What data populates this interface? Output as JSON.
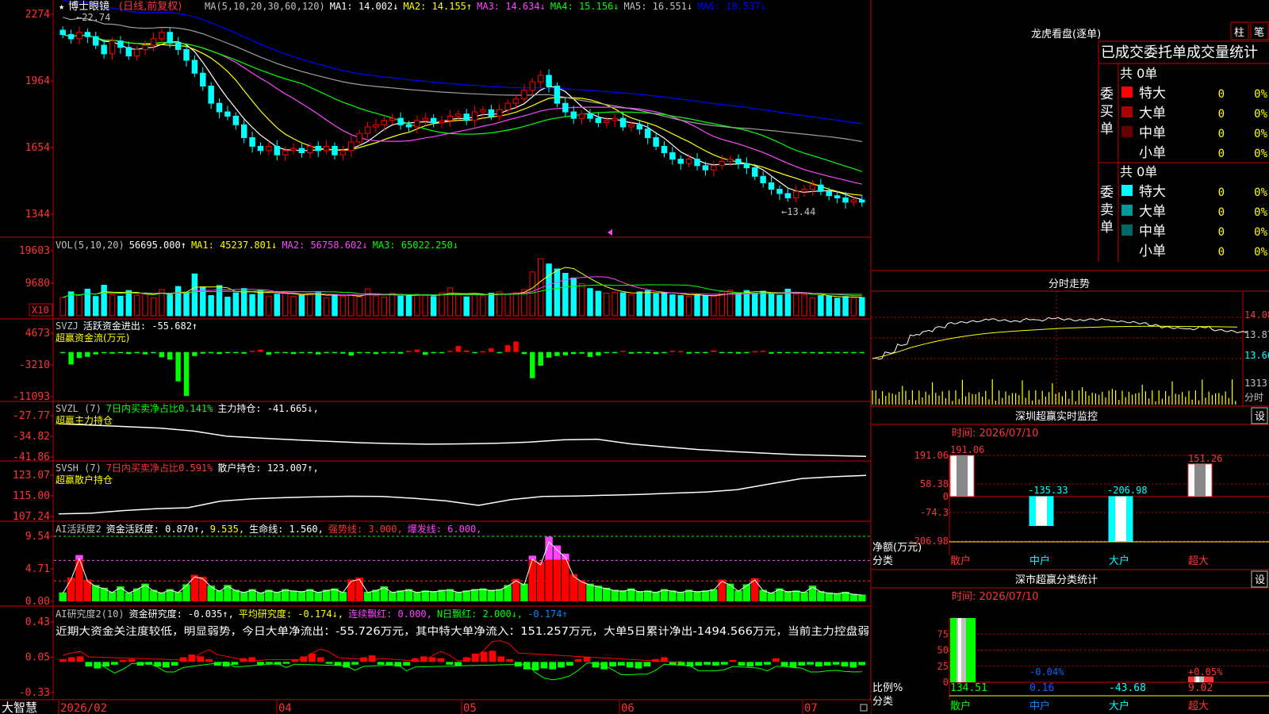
{
  "left": {
    "main": {
      "star_prefix": "★",
      "stock_name": "博士眼镜",
      "period_label": "(日线,前复权)",
      "ma_legend": [
        {
          "text": "MA(5,10,20,30,60,120)",
          "color": "#c0c0c0"
        },
        {
          "text": "MA1: 14.002↓",
          "color": "#ffffff"
        },
        {
          "text": "MA2: 14.155↑",
          "color": "#ffff00"
        },
        {
          "text": "MA3: 14.634↓",
          "color": "#ff44ff"
        },
        {
          "text": "MA4: 15.156↓",
          "color": "#00ff00"
        },
        {
          "text": "MA5: 16.551↓",
          "color": "#c0c0c0"
        },
        {
          "text": "MA6: 18.537↓",
          "color": "#0000ff"
        }
      ],
      "y_ticks": [
        "2274",
        "1964",
        "1654",
        "1344"
      ],
      "high_label": "←22.74",
      "low_label": "←13.44"
    },
    "vol": {
      "legend": [
        {
          "text": "VOL(5,10,20)",
          "color": "#c0c0c0"
        },
        {
          "text": "56695.000↑",
          "color": "#ffffff"
        },
        {
          "text": "MA1: 45237.801↓",
          "color": "#ffff00"
        },
        {
          "text": "MA2: 56758.602↓",
          "color": "#ff44ff"
        },
        {
          "text": "MA3: 65022.250↓",
          "color": "#00ff00"
        }
      ],
      "y_ticks": [
        "19603",
        "9680"
      ],
      "unit_label": "X10"
    },
    "svzj": {
      "legend": [
        {
          "text": "SVZJ",
          "color": "#c0c0c0"
        },
        {
          "text": "活跃资金进出: -55.682↑",
          "color": "#ffffff"
        }
      ],
      "subtitle": "超赢资金流(万元)",
      "y_ticks": [
        "4673",
        "-3210",
        "-11093"
      ]
    },
    "svzl": {
      "legend": [
        {
          "text": "SVZL (7)",
          "color": "#c0c0c0"
        },
        {
          "text": "7日内买卖净占比0.141%",
          "color": "#00ff00"
        },
        {
          "text": "主力持仓: -41.665↓,",
          "color": "#ffffff"
        }
      ],
      "subtitle": "超赢主力持仓",
      "y_ticks": [
        "-27.77",
        "-34.82",
        "-41.86"
      ]
    },
    "svsh": {
      "legend": [
        {
          "text": "SVSH (7)",
          "color": "#c0c0c0"
        },
        {
          "text": "7日内买卖净占比0.591%",
          "color": "#ff3333"
        },
        {
          "text": "散户持仓: 123.007↑,",
          "color": "#ffffff"
        }
      ],
      "subtitle": "超赢散户持仓",
      "y_ticks": [
        "123.07",
        "115.00",
        "107.24"
      ]
    },
    "ai_active": {
      "legend": [
        {
          "text": "AI活跃度2",
          "color": "#c0c0c0"
        },
        {
          "text": "资金活跃度: 0.870↑,",
          "color": "#ffffff"
        },
        {
          "text": "9.535,",
          "color": "#ffff00"
        },
        {
          "text": "生命线: 1.560,",
          "color": "#ffffff"
        },
        {
          "text": "强势线: 3.000,",
          "color": "#ff3333"
        },
        {
          "text": "爆发线: 6.000,",
          "color": "#ff44ff"
        }
      ],
      "y_ticks": [
        "9.54",
        "4.71",
        "0.00"
      ]
    },
    "ai_research": {
      "legend": [
        {
          "text": "AI研究度2(10)",
          "color": "#c0c0c0"
        },
        {
          "text": "资金研究度: -0.035↑,",
          "color": "#ffffff"
        },
        {
          "text": "平均研究度: -0.174↓,",
          "color": "#ffff00"
        },
        {
          "text": "连续飘红: 0.000,",
          "color": "#ff44ff"
        },
        {
          "text": "N日飘红: 2.000↓,",
          "color": "#00ff00"
        },
        {
          "text": "-0.174↑",
          "color": "#0088ff"
        }
      ],
      "commentary": "近期大资金关注度较低，明显弱势，今日大单净流出：-55.726万元，其中特大单净流入：151.257万元，大单5日累计净出-1494.566万元，当前主力控盘弱",
      "y_ticks": [
        "0.43",
        "0.05",
        "-0.33"
      ]
    },
    "time_axis": {
      "brand": "大智慧",
      "labels": [
        "2026/02",
        "04",
        "05",
        "06",
        "07"
      ]
    }
  },
  "right": {
    "order_panel": {
      "title": "龙虎看盘(逐单)",
      "tab_bar": "柱",
      "tab_stroke": "笔",
      "header": "已成交委托单成交量统计",
      "buy": {
        "side_label": "委买单",
        "total": "共 0单",
        "rows": [
          {
            "label": "特大",
            "count": "0",
            "pct": "0%",
            "color": "#ff0000"
          },
          {
            "label": "大单",
            "count": "0",
            "pct": "0%",
            "color": "#aa0000"
          },
          {
            "label": "中单",
            "count": "0",
            "pct": "0%",
            "color": "#660000"
          },
          {
            "label": "小单",
            "count": "0",
            "pct": "0%",
            "color": ""
          }
        ]
      },
      "sell": {
        "side_label": "委卖单",
        "total": "共 0单",
        "rows": [
          {
            "label": "特大",
            "count": "0",
            "pct": "0%",
            "color": "#00ffff"
          },
          {
            "label": "大单",
            "count": "0",
            "pct": "0%",
            "color": "#009999"
          },
          {
            "label": "中单",
            "count": "0",
            "pct": "0%",
            "color": "#006666"
          },
          {
            "label": "小单",
            "count": "0",
            "pct": "0%",
            "color": ""
          }
        ]
      }
    },
    "intraday": {
      "title": "分时走势",
      "price_ticks": [
        "14.08",
        "13.87",
        "13.66"
      ],
      "vol_tick": "1313",
      "vol_unit": "分时"
    },
    "monitor": {
      "title": "深圳超赢实时监控",
      "settings": "设",
      "time": "时间: 2026/07/10",
      "y_ticks": [
        "191.06",
        "58.38",
        "0",
        "-74.3",
        "-206.98"
      ],
      "net_label": "净额(万元)",
      "cat_label": "分类",
      "categories": [
        "散户",
        "中户",
        "大户",
        "超大"
      ],
      "values": [
        191.06,
        -135.33,
        -206.98,
        151.26
      ],
      "value_labels": [
        "191.06",
        "-135.33",
        "-206.98",
        "151.26"
      ]
    },
    "classify": {
      "title": "深市超赢分类统计",
      "settings": "设",
      "time": "时间: 2026/07/10",
      "y_ticks": [
        "75",
        "50",
        "25",
        "0"
      ],
      "ratio_label": "比例%",
      "cat_label": "分类",
      "categories": [
        "散户",
        "中户",
        "大户",
        "超大"
      ],
      "values": [
        134.51,
        0.16,
        -43.68,
        9.02
      ],
      "bottom_labels": [
        "134.51",
        "0.16",
        "-43.68",
        "9.02"
      ],
      "top_labels": [
        "",
        "-0.04%",
        "",
        "+0.05%"
      ]
    }
  },
  "chart_data": [
    {
      "type": "candlestick",
      "title": "博士眼镜(日线,前复权)",
      "x": [
        "2026/02",
        "04",
        "05",
        "06",
        "07"
      ],
      "ylim": [
        13.44,
        22.74
      ],
      "y_ticks": [
        22.74,
        19.64,
        16.54,
        13.44
      ],
      "close": [
        21.8,
        21.6,
        21.9,
        21.7,
        21.3,
        20.9,
        21.5,
        21.2,
        20.8,
        21.1,
        21.3,
        21.6,
        21.9,
        21.4,
        21.1,
        20.6,
        20.0,
        19.4,
        18.6,
        18.2,
        18.0,
        17.6,
        17.0,
        16.6,
        16.4,
        16.6,
        16.2,
        16.4,
        16.5,
        16.3,
        16.6,
        16.4,
        16.6,
        16.2,
        16.4,
        16.8,
        17.2,
        17.5,
        17.6,
        17.8,
        17.9,
        17.6,
        17.5,
        17.8,
        17.9,
        17.7,
        17.8,
        18.0,
        18.1,
        17.8,
        18.2,
        18.3,
        18.0,
        18.3,
        18.6,
        18.8,
        19.2,
        19.6,
        19.9,
        19.4,
        18.6,
        18.2,
        17.9,
        18.1,
        17.9,
        17.7,
        17.8,
        17.9,
        17.5,
        17.6,
        17.4,
        17.0,
        16.6,
        16.3,
        16.0,
        15.8,
        16.0,
        15.7,
        15.5,
        15.7,
        15.9,
        16.0,
        15.8,
        15.6,
        15.2,
        14.9,
        14.6,
        14.4,
        14.2,
        14.5,
        14.6,
        14.8,
        14.5,
        14.3,
        14.2,
        14.0,
        14.1,
        14.0
      ],
      "series": [
        {
          "name": "MA1",
          "value": 14.002
        },
        {
          "name": "MA2",
          "value": 14.155
        },
        {
          "name": "MA3",
          "value": 14.634
        },
        {
          "name": "MA4",
          "value": 15.156
        },
        {
          "name": "MA5",
          "value": 16.551
        },
        {
          "name": "MA6",
          "value": 18.537
        }
      ]
    },
    {
      "type": "bar",
      "title": "VOL(5,10,20)",
      "ylim": [
        0,
        19603
      ],
      "y_ticks": [
        19603,
        9680
      ],
      "values": [
        5500,
        7200,
        6100,
        8000,
        5800,
        9200,
        6400,
        5900,
        7600,
        6200,
        6800,
        5400,
        7900,
        6300,
        8800,
        7100,
        12600,
        8700,
        6100,
        9100,
        5600,
        6900,
        8200,
        6400,
        7800,
        5900,
        6500,
        7100,
        5800,
        6200,
        6600,
        7000,
        5400,
        6100,
        5900,
        6300,
        5700,
        8100,
        6000,
        5600,
        6700,
        5900,
        6200,
        6500,
        6100,
        5800,
        6900,
        8400,
        6300,
        5700,
        6400,
        6000,
        6800,
        7200,
        6500,
        6900,
        7900,
        13200,
        17200,
        15600,
        14100,
        12800,
        11400,
        9700,
        8200,
        7400,
        6800,
        7100,
        6900,
        6400,
        7200,
        7600,
        6600,
        6900,
        6300,
        6100,
        5800,
        6400,
        6000,
        5900,
        7300,
        7700,
        6700,
        7600,
        6800,
        7400,
        6700,
        6200,
        8000,
        6600,
        6300,
        5400,
        6100,
        5900,
        5300,
        5800,
        5400,
        5500
      ]
    },
    {
      "type": "bar",
      "title": "SVZJ 活跃资金进出",
      "ylim": [
        -11093,
        4673
      ],
      "y_ticks": [
        4673,
        -3210,
        -11093
      ],
      "values": [
        -200,
        -3100,
        -1500,
        -1200,
        -600,
        -300,
        -400,
        -300,
        -500,
        -200,
        -600,
        -300,
        -1300,
        -1900,
        -7300,
        -10900,
        -1000,
        -400,
        -200,
        -500,
        -300,
        -200,
        -400,
        300,
        600,
        -700,
        -300,
        -200,
        -500,
        -300,
        -200,
        -600,
        -300,
        -200,
        -400,
        -900,
        -300,
        -200,
        -500,
        -300,
        -200,
        -400,
        300,
        600,
        -700,
        -300,
        -200,
        300,
        1500,
        400,
        -300,
        200,
        900,
        -200,
        1700,
        2600,
        -500,
        -6500,
        -3400,
        -1400,
        -1000,
        -800,
        -500,
        -400,
        -1200,
        -900,
        -300,
        -200,
        300,
        -400,
        -300,
        -200,
        -500,
        -300,
        300,
        200,
        -400,
        -300,
        -200,
        400,
        -300,
        -200,
        -400,
        -300,
        200,
        300,
        -400,
        -300,
        -200,
        -300,
        -200,
        -300,
        -400,
        -200,
        -300,
        -200,
        -300,
        -100
      ]
    },
    {
      "type": "line",
      "title": "SVZL 主力持仓",
      "ylim": [
        -41.86,
        -27.77
      ],
      "y_ticks": [
        -27.77,
        -34.82,
        -41.86
      ],
      "values": [
        -30.5,
        -31.0,
        -31.5,
        -32.0,
        -33.0,
        -34.8,
        -35.4,
        -36.0,
        -36.5,
        -37.0,
        -37.3,
        -37.5,
        -37.4,
        -37.2,
        -36.8,
        -36.0,
        -35.8,
        -37.4,
        -38.4,
        -39.3,
        -40.0,
        -40.6,
        -41.1,
        -41.4,
        -41.665
      ]
    },
    {
      "type": "line",
      "title": "SVSH 散户持仓",
      "ylim": [
        107.24,
        123.07
      ],
      "y_ticks": [
        123.07,
        115.0,
        107.24
      ],
      "values": [
        108.2,
        108.5,
        109.5,
        110.2,
        110.6,
        113.1,
        114.0,
        114.5,
        114.8,
        115.0,
        114.9,
        114.2,
        113.2,
        111.5,
        113.7,
        114.9,
        115.1,
        115.4,
        115.7,
        116.2,
        116.6,
        117.5,
        119.7,
        121.8,
        122.5,
        123.007
      ]
    },
    {
      "type": "bar",
      "title": "AI活跃度2",
      "ylim": [
        0,
        9.54
      ],
      "y_ticks": [
        9.54,
        4.71,
        0.0
      ],
      "values": [
        1.3,
        3.5,
        6.8,
        3.2,
        2.4,
        2.0,
        1.4,
        2.2,
        1.3,
        1.9,
        2.6,
        1.7,
        1.3,
        1.8,
        1.4,
        2.5,
        3.9,
        3.6,
        2.3,
        1.6,
        2.4,
        1.7,
        1.4,
        1.8,
        1.3,
        1.7,
        1.4,
        1.8,
        1.6,
        1.5,
        1.8,
        1.4,
        1.7,
        1.9,
        1.4,
        3.2,
        3.5,
        1.4,
        1.7,
        2.2,
        1.4,
        1.6,
        1.8,
        1.4,
        1.6,
        1.5,
        1.7,
        1.8,
        1.4,
        1.6,
        1.8,
        1.9,
        1.7,
        1.8,
        2.4,
        3.3,
        2.6,
        6.7,
        5.8,
        9.5,
        8.2,
        7.0,
        4.0,
        3.1,
        2.6,
        2.3,
        2.0,
        1.7,
        1.6,
        1.9,
        1.5,
        1.6,
        1.4,
        1.8,
        1.6,
        1.4,
        1.7,
        1.5,
        1.6,
        1.8,
        3.2,
        2.6,
        1.6,
        2.5,
        3.4,
        1.7,
        1.3,
        1.9,
        1.5,
        1.6,
        1.4,
        2.3,
        1.5,
        1.3,
        1.2,
        1.4,
        1.1,
        1.0
      ],
      "lines": [
        {
          "name": "生命线",
          "value": 1.56
        },
        {
          "name": "强势线",
          "value": 3.0
        },
        {
          "name": "爆发线",
          "value": 6.0
        }
      ]
    },
    {
      "type": "bar",
      "title": "AI研究度2(10)",
      "ylim": [
        -0.33,
        0.43
      ],
      "y_ticks": [
        0.43,
        0.05,
        -0.33
      ],
      "values": [
        0.03,
        0.05,
        0.06,
        -0.05,
        -0.07,
        -0.05,
        -0.03,
        0.02,
        0.03,
        -0.04,
        -0.03,
        -0.05,
        -0.06,
        -0.04,
        0.05,
        0.08,
        0.06,
        0.03,
        -0.04,
        -0.05,
        -0.03,
        0.04,
        0.05,
        -0.03,
        -0.02,
        -0.03,
        -0.02,
        0.03,
        0.06,
        0.09,
        0.05,
        -0.02,
        -0.04,
        -0.06,
        -0.03,
        0.05,
        0.07,
        -0.03,
        -0.04,
        -0.05,
        -0.04,
        0.04,
        0.06,
        0.05,
        0.04,
        -0.03,
        -0.04,
        0.05,
        0.09,
        0.11,
        0.12,
        0.06,
        0.03,
        -0.05,
        -0.08,
        -0.09,
        -0.07,
        -0.08,
        -0.06,
        -0.04,
        0.03,
        0.05,
        -0.06,
        -0.08,
        -0.05,
        -0.04,
        -0.06,
        -0.07,
        -0.05,
        0.03,
        0.05,
        -0.03,
        -0.04,
        -0.05,
        -0.04,
        -0.03,
        -0.04,
        -0.03,
        0.02,
        -0.04,
        -0.05,
        -0.04,
        -0.03,
        0.04,
        -0.05,
        -0.06,
        -0.04,
        -0.03,
        -0.05,
        -0.04,
        -0.03,
        -0.05,
        -0.06,
        -0.035
      ]
    },
    {
      "type": "line",
      "title": "分时走势",
      "ylim": [
        13.66,
        14.08
      ],
      "values": [
        13.66,
        13.72,
        13.8,
        13.9,
        13.94,
        13.98,
        14.02,
        14.03,
        14.04,
        14.06,
        14.05,
        14.04,
        14.06,
        14.05,
        14.07,
        14.06,
        14.05,
        14.06,
        14.06,
        14.04,
        14.03,
        14.02,
        14.0,
        13.98,
        13.97,
        13.96,
        13.98,
        13.95,
        13.94,
        13.93
      ]
    },
    {
      "type": "bar",
      "title": "深圳超赢实时监控",
      "categories": [
        "散户",
        "中户",
        "大户",
        "超大"
      ],
      "values": [
        191.06,
        -135.33,
        -206.98,
        151.26
      ],
      "ylim": [
        -206.98,
        191.06
      ],
      "ylabel": "净额(万元)",
      "xlabel": "分类"
    },
    {
      "type": "bar",
      "title": "深市超赢分类统计",
      "categories": [
        "散户",
        "中户",
        "大户",
        "超大"
      ],
      "values": [
        134.51,
        0.16,
        -43.68,
        9.02
      ],
      "ylim": [
        0,
        75
      ],
      "ylabel": "比例%",
      "xlabel": "分类"
    }
  ]
}
